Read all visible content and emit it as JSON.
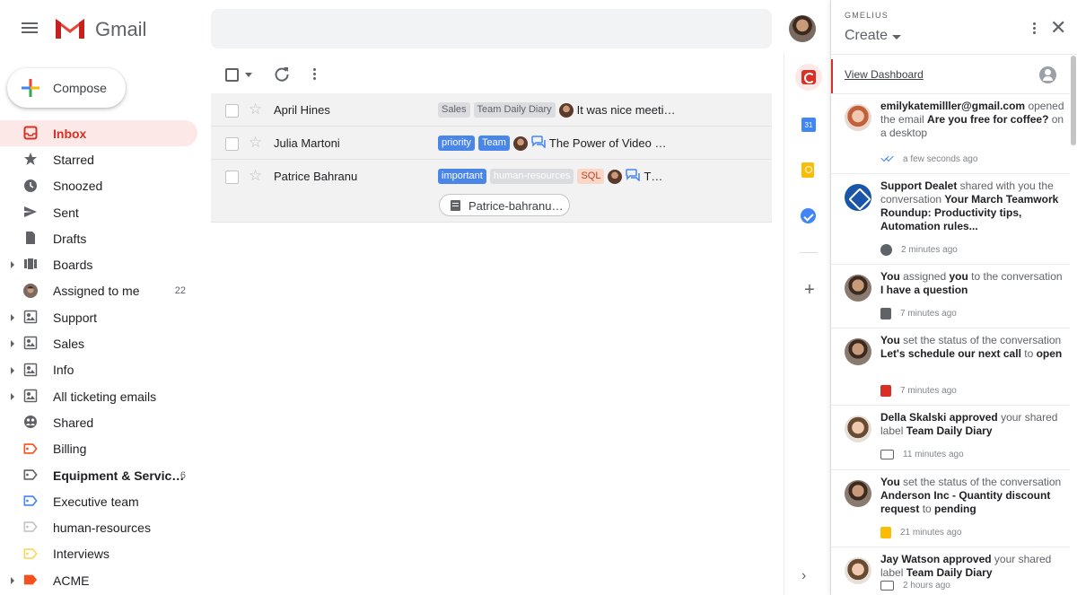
{
  "header": {
    "app_name": "Gmail"
  },
  "compose": {
    "label": "Compose"
  },
  "nav": [
    {
      "label": "Inbox",
      "icon": "inbox-icon",
      "active": true,
      "caret": false
    },
    {
      "label": "Starred",
      "icon": "star-icon",
      "caret": false
    },
    {
      "label": "Snoozed",
      "icon": "clock-icon",
      "caret": false
    },
    {
      "label": "Sent",
      "icon": "send-icon",
      "caret": false
    },
    {
      "label": "Drafts",
      "icon": "draft-icon",
      "caret": false
    },
    {
      "label": "Boards",
      "icon": "boards-icon",
      "caret": true
    },
    {
      "label": "Assigned to me",
      "icon": "avatar-icon",
      "count": "22",
      "caret": false
    },
    {
      "label": "Support",
      "icon": "shared-inbox-icon",
      "caret": true
    },
    {
      "label": "Sales",
      "icon": "shared-inbox-icon",
      "caret": true
    },
    {
      "label": "Info",
      "icon": "shared-inbox-icon",
      "caret": true
    },
    {
      "label": "All ticketing emails",
      "icon": "shared-inbox-icon",
      "caret": true
    },
    {
      "label": "Shared",
      "icon": "shared-icon",
      "caret": false
    },
    {
      "label": "Billing",
      "icon": "label-icon",
      "color": "#f4511e",
      "caret": false
    },
    {
      "label": "Equipment & Servic…",
      "icon": "label-icon",
      "color": "#5f6368",
      "count": "6",
      "bold": true,
      "caret": false
    },
    {
      "label": "Executive team",
      "icon": "label-icon",
      "color": "#4285f4",
      "caret": false
    },
    {
      "label": "human-resources",
      "icon": "label-icon",
      "color": "#c4c4c4",
      "caret": false
    },
    {
      "label": "Interviews",
      "icon": "label-icon",
      "color": "#fbd75b",
      "caret": false
    },
    {
      "label": "ACME",
      "icon": "label-filled-icon",
      "color": "#f4511e",
      "caret": true
    }
  ],
  "emails": [
    {
      "sender": "April Hines",
      "tags": [
        {
          "text": "Sales",
          "style": "gray"
        },
        {
          "text": "Team Daily Diary",
          "style": "gray"
        }
      ],
      "snippet": "It was nice meeti…"
    },
    {
      "sender": "Julia Martoni",
      "tags": [
        {
          "text": "priority",
          "style": "blue"
        },
        {
          "text": "Team",
          "style": "blue"
        }
      ],
      "snippet": "The Power of Video …",
      "chat": true
    },
    {
      "sender": "Patrice Bahranu",
      "tags": [
        {
          "text": "important",
          "style": "blue"
        },
        {
          "text": "human-resources",
          "style": "graylight"
        },
        {
          "text": "SQL",
          "style": "orange"
        }
      ],
      "snippet": "T…",
      "chat": true,
      "attachment": "Patrice-bahranu…"
    }
  ],
  "rail": {
    "calendar_day": "31"
  },
  "panel": {
    "brand": "GMELIUS",
    "create_label": "Create",
    "dashboard_link": "View Dashboard",
    "activities": [
      {
        "avatar": "woman1",
        "html": "<b>emilykatemilller@gmail.com</b> opened the email <b>Are you free for coffee?</b> on a desktop",
        "time": "a few seconds ago",
        "meta_icon": "ticks"
      },
      {
        "avatar": "support",
        "html": "<b>Support Dealet</b> shared with you the conversation <b>Your March Teamwork Roundup: Productivity tips, Automation rules...</b>",
        "time": "2 minutes ago",
        "meta_icon": "shared"
      },
      {
        "avatar": "man",
        "html": "<b>You</b> assigned <b>you</b> to the conversation <b>I have a question</b>",
        "time": "7 minutes ago",
        "meta_icon": "assign"
      },
      {
        "avatar": "man",
        "html": "<b>You</b> set the status of the conversation <b>Let's schedule our next call</b> to <b>open</b>",
        "time": "7 minutes ago",
        "meta_icon": "status-red"
      },
      {
        "avatar": "woman2",
        "html": "<b>Della Skalski approved</b> your shared label <b>Team Daily Diary</b>",
        "time": "11 minutes ago",
        "meta_icon": "label"
      },
      {
        "avatar": "man",
        "html": "<b>You</b> set the status of the conversation <b>Anderson Inc - Quantity discount request</b> to <b>pending</b>",
        "time": "21 minutes ago",
        "meta_icon": "status-yellow"
      },
      {
        "avatar": "woman2",
        "html": "<b>Jay Watson approved</b> your shared label <b>Team Daily Diary</b>",
        "time": "2 hours ago",
        "meta_icon": "label"
      }
    ]
  }
}
